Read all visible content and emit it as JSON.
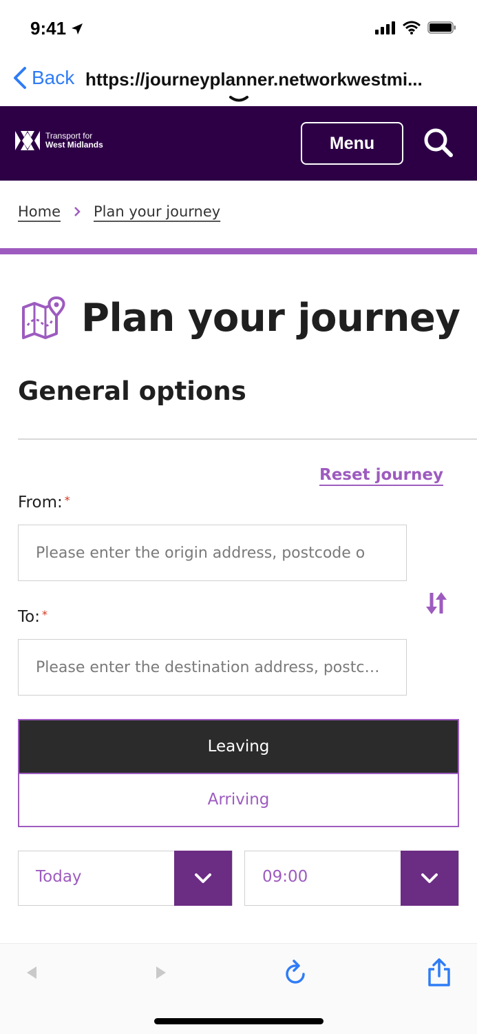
{
  "status_bar": {
    "time": "9:41"
  },
  "browser": {
    "back_label": "Back",
    "url": "https://journeyplanner.networkwestmi..."
  },
  "header": {
    "logo_line1": "Transport for",
    "logo_line2": "West Midlands",
    "menu_label": "Menu"
  },
  "breadcrumb": {
    "items": [
      "Home",
      "Plan your journey"
    ]
  },
  "page": {
    "title": "Plan your journey",
    "section_title": "General options",
    "reset_label": "Reset journey"
  },
  "form": {
    "from_label": "From:",
    "from_placeholder": "Please enter the origin address, postcode o",
    "to_label": "To:",
    "to_placeholder": "Please enter the destination address, postc…",
    "required_mark": "*"
  },
  "mode_toggle": {
    "leaving": "Leaving",
    "arriving": "Arriving",
    "selected": "Leaving"
  },
  "when": {
    "day_value": "Today",
    "time_value": "09:00"
  },
  "colors": {
    "brand_dark": "#2d0046",
    "accent_purple": "#9d5bbf",
    "select_purple": "#6b2c84",
    "link_blue": "#2f7cf6"
  },
  "icons": {
    "status": [
      "location-arrow-icon",
      "signal-icon",
      "wifi-icon",
      "battery-icon"
    ],
    "toolbar": [
      "back-arrow-icon",
      "forward-arrow-icon",
      "reload-icon",
      "share-icon"
    ]
  }
}
